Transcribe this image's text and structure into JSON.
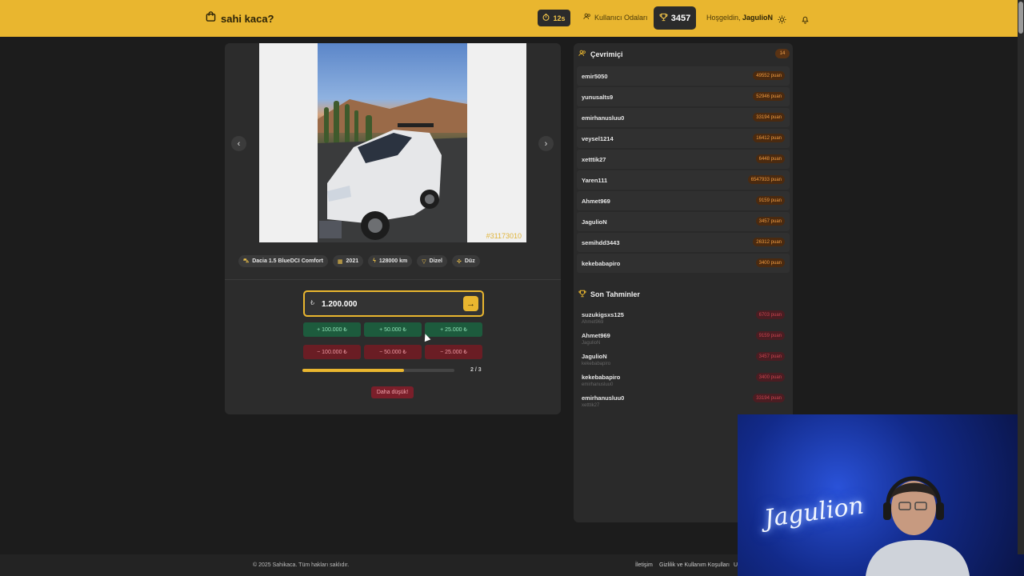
{
  "header": {
    "logo_text": "sahi kaca?",
    "timer": "12s",
    "rooms_label": "Kullanıcı Odaları",
    "score": "3457",
    "greeting_prefix": "Hoşgeldin,",
    "username": "JagulioN"
  },
  "listing": {
    "photo_id": "#31173010",
    "tags": [
      {
        "icon": "car-icon",
        "label": "Dacia 1.5 BlueDCI Comfort"
      },
      {
        "icon": "calendar-icon",
        "label": "2021"
      },
      {
        "icon": "gauge-icon",
        "label": "128000 km"
      },
      {
        "icon": "fuel-icon",
        "label": "Dizel"
      },
      {
        "icon": "gear-icon",
        "label": "Düz"
      }
    ]
  },
  "guess": {
    "currency_symbol": "₺",
    "value": "1.200.000",
    "plus_steps": [
      "+ 100.000 ₺",
      "+ 50.000 ₺",
      "+ 25.000 ₺"
    ],
    "minus_steps": [
      "− 100.000 ₺",
      "− 50.000 ₺",
      "− 25.000 ₺"
    ],
    "progress_text": "2 / 3",
    "progress_fraction": 0.67,
    "hint": "Daha düşük!"
  },
  "online": {
    "title": "Çevrimiçi",
    "count": "14",
    "users": [
      {
        "name": "emir5050",
        "points": "49552 puan"
      },
      {
        "name": "yunusalts9",
        "points": "52946 puan"
      },
      {
        "name": "emirhanusluu0",
        "points": "33194 puan"
      },
      {
        "name": "veysel1214",
        "points": "16412 puan"
      },
      {
        "name": "xetttik27",
        "points": "6448 puan"
      },
      {
        "name": "Yaren111",
        "points": "6547933 puan"
      },
      {
        "name": "Ahmet969",
        "points": "9159 puan"
      },
      {
        "name": "JagulioN",
        "points": "3457 puan"
      },
      {
        "name": "semihdd3443",
        "points": "26312 puan"
      },
      {
        "name": "kekebabapiro",
        "points": "3400 puan"
      }
    ]
  },
  "recent": {
    "title": "Son Tahminler",
    "guesses": [
      {
        "name": "suzukigsxs125",
        "sub": "Ahmet969",
        "points": "6703 puan"
      },
      {
        "name": "Ahmet969",
        "sub": "JagulioN",
        "points": "9159 puan"
      },
      {
        "name": "JagulioN",
        "sub": "kekebabapiro",
        "points": "3457 puan"
      },
      {
        "name": "kekebabapiro",
        "sub": "emirhanusluu0",
        "points": "3400 puan"
      },
      {
        "name": "emirhanusluu0",
        "sub": "xetttik27",
        "points": "33194 puan"
      }
    ]
  },
  "webcam": {
    "neon_text": "Jagulion"
  },
  "footer": {
    "copyright": "© 2025 Sahikaca. Tüm hakları saklıdır.",
    "links": [
      "İletişim",
      "Gizlilik ve Kullanım Koşulları",
      "U"
    ]
  },
  "colors": {
    "accent": "#e9b62f",
    "background": "#1c1c1c",
    "panel": "#2c2c2c",
    "plus": "#1d5b3d",
    "minus": "#6a1d24"
  }
}
